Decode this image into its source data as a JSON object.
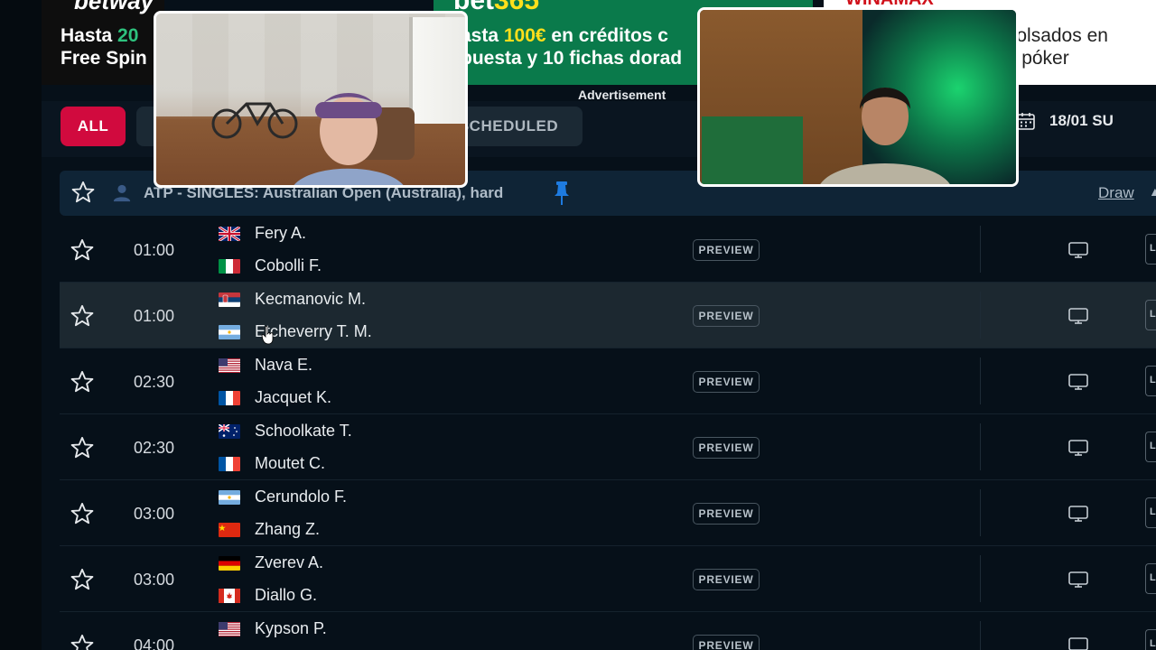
{
  "ads": {
    "betway": {
      "brand": "betway",
      "line1_pre": "Hasta ",
      "line1_hl": "20",
      "line2": "Free Spin"
    },
    "bet365": {
      "brand_a": "bet",
      "brand_b": "365",
      "line1_pre": "asta ",
      "line1_hl": "100€",
      "line1_post": " en créditos c",
      "line2": "puesta y 10 fichas dorad"
    },
    "winamax": {
      "brand": "WINAMAX",
      "line1": "nbolsados en",
      "line2": "no póker"
    },
    "label": "Advertisement"
  },
  "filters": {
    "all": "ALL",
    "live": "",
    "scheduled": "SCHEDULED",
    "date": "18/01 SU"
  },
  "tournament": {
    "title": "ATP - SINGLES: Australian Open (Australia), hard",
    "draw_link": "Draw"
  },
  "matches": [
    {
      "time": "01:00",
      "p1": "Fery A.",
      "p1_flag": "gb",
      "p2": "Cobolli F.",
      "p2_flag": "it",
      "preview": "PREVIEW",
      "live": "LI"
    },
    {
      "time": "01:00",
      "p1": "Kecmanovic M.",
      "p1_flag": "rs",
      "p2": "Etcheverry T. M.",
      "p2_flag": "ar",
      "preview": "PREVIEW",
      "live": "LI",
      "highlighted": true
    },
    {
      "time": "02:30",
      "p1": "Nava E.",
      "p1_flag": "us",
      "p2": "Jacquet K.",
      "p2_flag": "fr",
      "preview": "PREVIEW",
      "live": "LI"
    },
    {
      "time": "02:30",
      "p1": "Schoolkate T.",
      "p1_flag": "au",
      "p2": "Moutet C.",
      "p2_flag": "fr",
      "preview": "PREVIEW",
      "live": "LI"
    },
    {
      "time": "03:00",
      "p1": "Cerundolo F.",
      "p1_flag": "ar",
      "p2": "Zhang Z.",
      "p2_flag": "cn",
      "preview": "PREVIEW",
      "live": "LI"
    },
    {
      "time": "03:00",
      "p1": "Zverev A.",
      "p1_flag": "de",
      "p2": "Diallo G.",
      "p2_flag": "ca",
      "preview": "PREVIEW",
      "live": "LI"
    },
    {
      "time": "04:00",
      "p1": "Kypson P.",
      "p1_flag": "us",
      "p2": "",
      "p2_flag": "",
      "preview": "PREVIEW",
      "live": "LI"
    }
  ],
  "colors": {
    "accent": "#d10a3e",
    "background": "#061019",
    "header": "#0f2436"
  }
}
